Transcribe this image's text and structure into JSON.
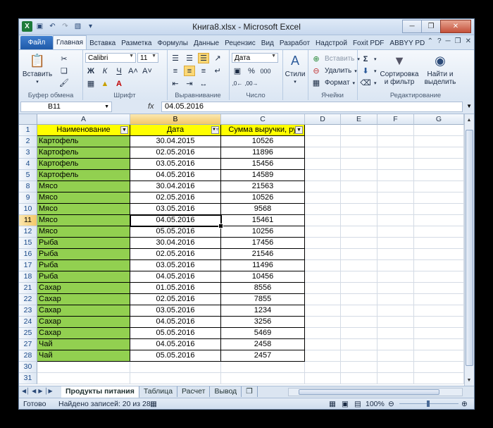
{
  "window": {
    "title": "Книга8.xlsx - Microsoft Excel"
  },
  "tabs": [
    "Файл",
    "Главная",
    "Вставка",
    "Разметка",
    "Формулы",
    "Данные",
    "Рецензис",
    "Вид",
    "Разработ",
    "Надстрой",
    "Foxit PDF",
    "ABBYY PD"
  ],
  "ribbon": {
    "paste": "Вставить",
    "clipboard": "Буфер обмена",
    "font_name": "Calibri",
    "font_size": "11",
    "font": "Шрифт",
    "align": "Выравнивание",
    "number_format": "Дата",
    "number": "Число",
    "styles": "Стили",
    "cells_insert": "Вставить",
    "cells_delete": "Удалить",
    "cells_format": "Формат",
    "cells": "Ячейки",
    "sort_filter": "Сортировка и фильтр",
    "find_select": "Найти и выделить",
    "editing": "Редактирование",
    "percent": "%",
    "thousands": "000"
  },
  "formula_bar": {
    "name_box": "B11",
    "fx": "fx",
    "value": "04.05.2016"
  },
  "columns": [
    "A",
    "B",
    "C",
    "D",
    "E",
    "F",
    "G"
  ],
  "headers": [
    "Наименование",
    "Дата",
    "Сумма выручки, ру"
  ],
  "rows": [
    {
      "n": "2",
      "a": "Картофель",
      "b": "30.04.2015",
      "c": "10526"
    },
    {
      "n": "3",
      "a": "Картофель",
      "b": "02.05.2016",
      "c": "11896"
    },
    {
      "n": "4",
      "a": "Картофель",
      "b": "03.05.2016",
      "c": "15456"
    },
    {
      "n": "5",
      "a": "Картофель",
      "b": "04.05.2016",
      "c": "14589"
    },
    {
      "n": "8",
      "a": "Мясо",
      "b": "30.04.2016",
      "c": "21563"
    },
    {
      "n": "9",
      "a": "Мясо",
      "b": "02.05.2016",
      "c": "10526"
    },
    {
      "n": "10",
      "a": "Мясо",
      "b": "03.05.2016",
      "c": "9568"
    },
    {
      "n": "11",
      "a": "Мясо",
      "b": "04.05.2016",
      "c": "15461"
    },
    {
      "n": "12",
      "a": "Мясо",
      "b": "05.05.2016",
      "c": "10256"
    },
    {
      "n": "15",
      "a": "Рыба",
      "b": "30.04.2016",
      "c": "17456"
    },
    {
      "n": "16",
      "a": "Рыба",
      "b": "02.05.2016",
      "c": "21546"
    },
    {
      "n": "17",
      "a": "Рыба",
      "b": "03.05.2016",
      "c": "11496"
    },
    {
      "n": "18",
      "a": "Рыба",
      "b": "04.05.2016",
      "c": "10456"
    },
    {
      "n": "21",
      "a": "Сахар",
      "b": "01.05.2016",
      "c": "8556"
    },
    {
      "n": "22",
      "a": "Сахар",
      "b": "02.05.2016",
      "c": "7855"
    },
    {
      "n": "23",
      "a": "Сахар",
      "b": "03.05.2016",
      "c": "1234"
    },
    {
      "n": "24",
      "a": "Сахар",
      "b": "04.05.2016",
      "c": "3256"
    },
    {
      "n": "25",
      "a": "Сахар",
      "b": "05.05.2016",
      "c": "5469"
    },
    {
      "n": "27",
      "a": "Чай",
      "b": "04.05.2016",
      "c": "2458"
    },
    {
      "n": "28",
      "a": "Чай",
      "b": "05.05.2016",
      "c": "2457"
    }
  ],
  "extra_rows": [
    "30",
    "31"
  ],
  "sheets": [
    "Продукты питания",
    "Таблица",
    "Расчет",
    "Вывод"
  ],
  "status": {
    "ready": "Готово",
    "found": "Найдено записей: 20 из 28",
    "zoom": "100%"
  },
  "colors": {
    "name_fill": "#92d050",
    "header_fill": "#ffff00",
    "accent": "#1f5aa9"
  }
}
